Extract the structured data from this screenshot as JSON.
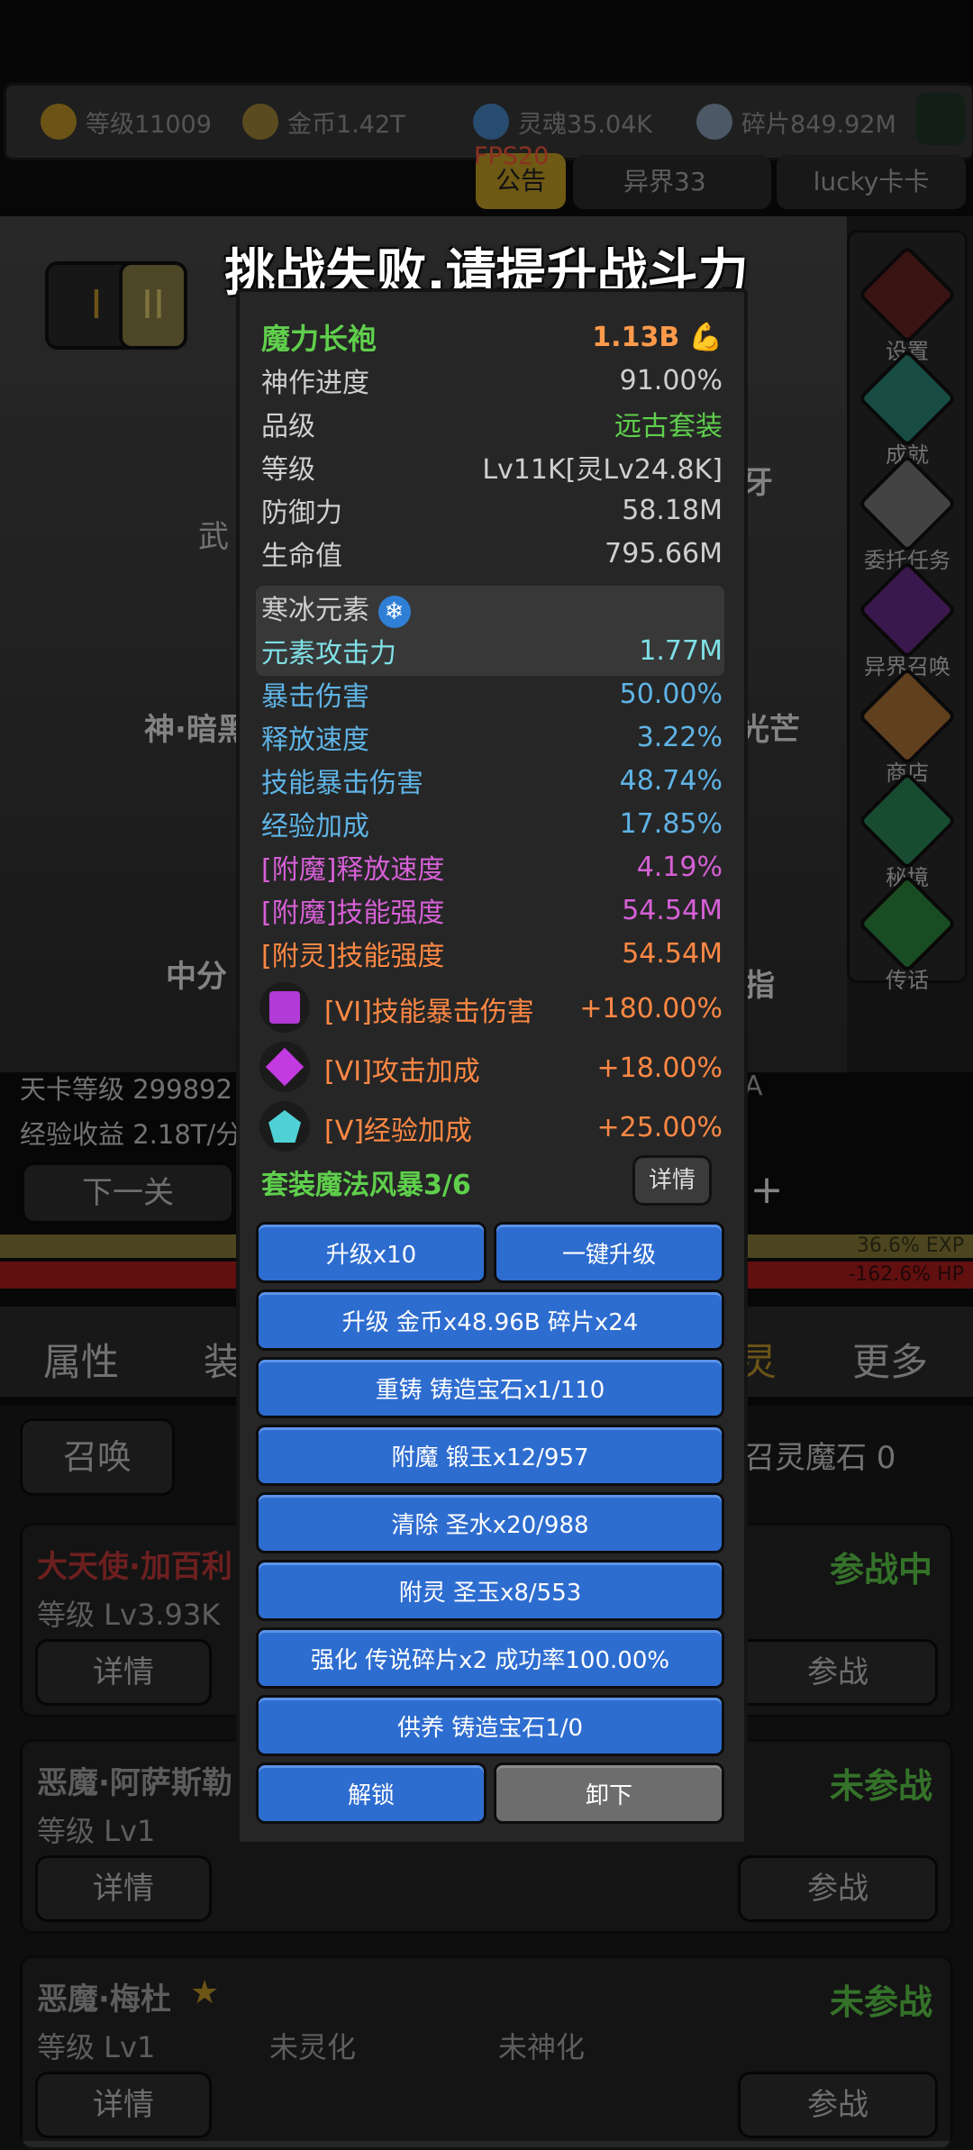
{
  "resources": [
    {
      "icon": "crown-icon",
      "label": "等级11009",
      "color": "#c59a2a"
    },
    {
      "icon": "coin-icon",
      "label": "金币1.42T",
      "color": "#a58a3a"
    },
    {
      "icon": "soul-icon",
      "label": "灵魂35.04K",
      "color": "#4a8acb"
    },
    {
      "icon": "shard-icon",
      "label": "碎片849.92M",
      "color": "#8aa0b8"
    }
  ],
  "fps": "FPS20",
  "top_tabs": {
    "notice": "公告",
    "otherworld": "异界33",
    "lucky": "lucky卡卡"
  },
  "toast": "挑战失败,请提升战斗力",
  "stage_buttons": [
    "I",
    "II"
  ],
  "scene_texts": {
    "left_weapon": "神·暗黑",
    "left_center": "中分",
    "wu": "武",
    "ya": "牙",
    "guangmang": "光芒",
    "zhi": "指",
    "a": "A"
  },
  "info": {
    "card_level": "天卡等级 299892",
    "exp_income": "经验收益 2.18T/分",
    "next_stage": "下一关"
  },
  "bars": {
    "exp": "36.6% EXP",
    "hp": "-162.6%  HP"
  },
  "sidebar": [
    "设置",
    "成就",
    "委托任务",
    "异界召唤",
    "商店",
    "秘境",
    "传话"
  ],
  "tabs": [
    "属性",
    "装",
    "灵",
    "更多"
  ],
  "summon": {
    "button": "召唤",
    "stone": "召灵魔石 0"
  },
  "units": [
    {
      "name": "大天使·加百利",
      "level": "等级 Lv3.93K",
      "status": "参战中",
      "detail": "详情",
      "action": "参战",
      "extra": []
    },
    {
      "name": "恶魔·阿萨斯勒",
      "level": "等级 Lv1",
      "status": "未参战",
      "detail": "详情",
      "action": "参战",
      "extra": []
    },
    {
      "name": "恶魔·梅杜",
      "level": "等级 Lv1",
      "status": "未参战",
      "detail": "详情",
      "action": "参战",
      "extra": [
        "未灵化",
        "未神化"
      ]
    }
  ],
  "item": {
    "name": "魔力长袍",
    "power": "1.13B",
    "stats": [
      {
        "k": "神作进度",
        "v": "91.00%"
      },
      {
        "k": "品级",
        "v": "远古套装"
      },
      {
        "k": "等级",
        "v": "Lv11K[灵Lv24.8K]"
      },
      {
        "k": "防御力",
        "v": "58.18M"
      },
      {
        "k": "生命值",
        "v": "795.66M"
      }
    ],
    "element": {
      "name": "寒冰元素",
      "attack_label": "元素攻击力",
      "attack": "1.77M"
    },
    "bonuses": [
      {
        "k": "暴击伤害",
        "v": "50.00%",
        "color": "#5fb4e6"
      },
      {
        "k": "释放速度",
        "v": "3.22%",
        "color": "#5fb4e6"
      },
      {
        "k": "技能暴击伤害",
        "v": "48.74%",
        "color": "#5fb4e6"
      },
      {
        "k": "经验加成",
        "v": "17.85%",
        "color": "#5fb4e6"
      },
      {
        "k": "[附魔]释放速度",
        "v": "4.19%",
        "color": "#d660d6"
      },
      {
        "k": "[附魔]技能强度",
        "v": "54.54M",
        "color": "#d660d6"
      },
      {
        "k": "[附灵]技能强度",
        "v": "54.54M",
        "color": "#ff8844"
      }
    ],
    "gems": [
      {
        "icon": "purple-gem-icon",
        "k": "[VI]技能暴击伤害",
        "v": "+180.00%",
        "color": "#b23ad6"
      },
      {
        "icon": "diamond-gem-icon",
        "k": "[VI]攻击加成",
        "v": "+18.00%",
        "color": "#c33ae0"
      },
      {
        "icon": "pentagon-gem-icon",
        "k": "[V]经验加成",
        "v": "+25.00%",
        "color": "#4fd1d6"
      }
    ],
    "set_bonus": "套装魔法风暴3/6",
    "detail_button": "详情",
    "buttons": {
      "upgrade10": "升级x10",
      "one_click": "一键升级",
      "upgrade": "升级 金币x48.96B 碎片x24",
      "recast": "重铸 铸造宝石x1/110",
      "enchant": "附魔 锻玉x12/957",
      "clear": "清除 圣水x20/988",
      "spirit": "附灵 圣玉x8/553",
      "enhance": "强化 传说碎片x2 成功率100.00%",
      "nurture": "供养 铸造宝石1/0",
      "unlock": "解锁",
      "unequip": "卸下"
    }
  }
}
